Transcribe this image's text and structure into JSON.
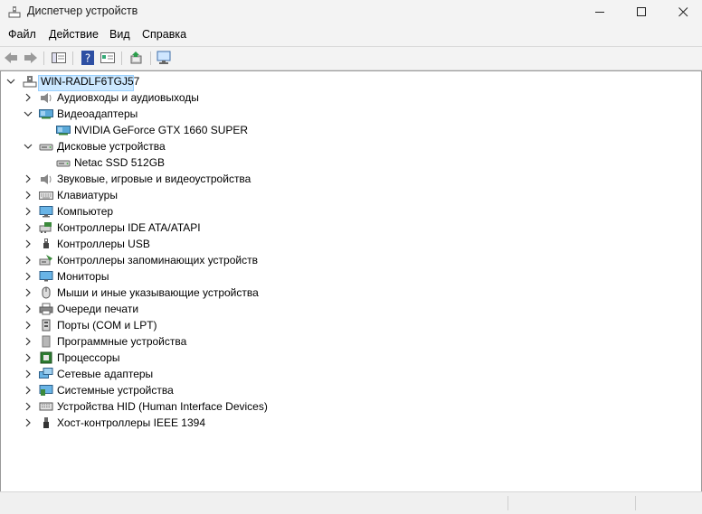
{
  "window": {
    "title": "Диспетчер устройств"
  },
  "menu": [
    "Файл",
    "Действие",
    "Вид",
    "Справка"
  ],
  "tree": {
    "root": "WIN-RADLF6TGJ57",
    "categories": [
      {
        "label": "Аудиовходы и аудиовыходы",
        "icon": "speaker-icon",
        "expanded": false
      },
      {
        "label": "Видеоадаптеры",
        "icon": "display-adapter-icon",
        "expanded": true,
        "children": [
          {
            "label": "NVIDIA GeForce GTX 1660 SUPER",
            "icon": "display-adapter-icon"
          }
        ]
      },
      {
        "label": "Дисковые устройства",
        "icon": "disk-drive-icon",
        "expanded": true,
        "children": [
          {
            "label": "Netac SSD 512GB",
            "icon": "disk-drive-icon"
          }
        ]
      },
      {
        "label": "Звуковые, игровые и видеоустройства",
        "icon": "speaker-icon",
        "expanded": false
      },
      {
        "label": "Клавиатуры",
        "icon": "keyboard-icon",
        "expanded": false
      },
      {
        "label": "Компьютер",
        "icon": "computer-icon",
        "expanded": false
      },
      {
        "label": "Контроллеры IDE ATA/ATAPI",
        "icon": "ide-controller-icon",
        "expanded": false
      },
      {
        "label": "Контроллеры USB",
        "icon": "usb-icon",
        "expanded": false
      },
      {
        "label": "Контроллеры запоминающих устройств",
        "icon": "storage-controller-icon",
        "expanded": false
      },
      {
        "label": "Мониторы",
        "icon": "monitor-icon",
        "expanded": false
      },
      {
        "label": "Мыши и иные указывающие устройства",
        "icon": "mouse-icon",
        "expanded": false
      },
      {
        "label": "Очереди печати",
        "icon": "printer-icon",
        "expanded": false
      },
      {
        "label": "Порты (COM и LPT)",
        "icon": "port-icon",
        "expanded": false
      },
      {
        "label": "Программные устройства",
        "icon": "software-device-icon",
        "expanded": false
      },
      {
        "label": "Процессоры",
        "icon": "processor-icon",
        "expanded": false
      },
      {
        "label": "Сетевые адаптеры",
        "icon": "network-adapter-icon",
        "expanded": false
      },
      {
        "label": "Системные устройства",
        "icon": "system-device-icon",
        "expanded": false
      },
      {
        "label": "Устройства HID (Human Interface Devices)",
        "icon": "hid-icon",
        "expanded": false
      },
      {
        "label": "Хост-контроллеры IEEE 1394",
        "icon": "ieee1394-icon",
        "expanded": false
      }
    ]
  }
}
